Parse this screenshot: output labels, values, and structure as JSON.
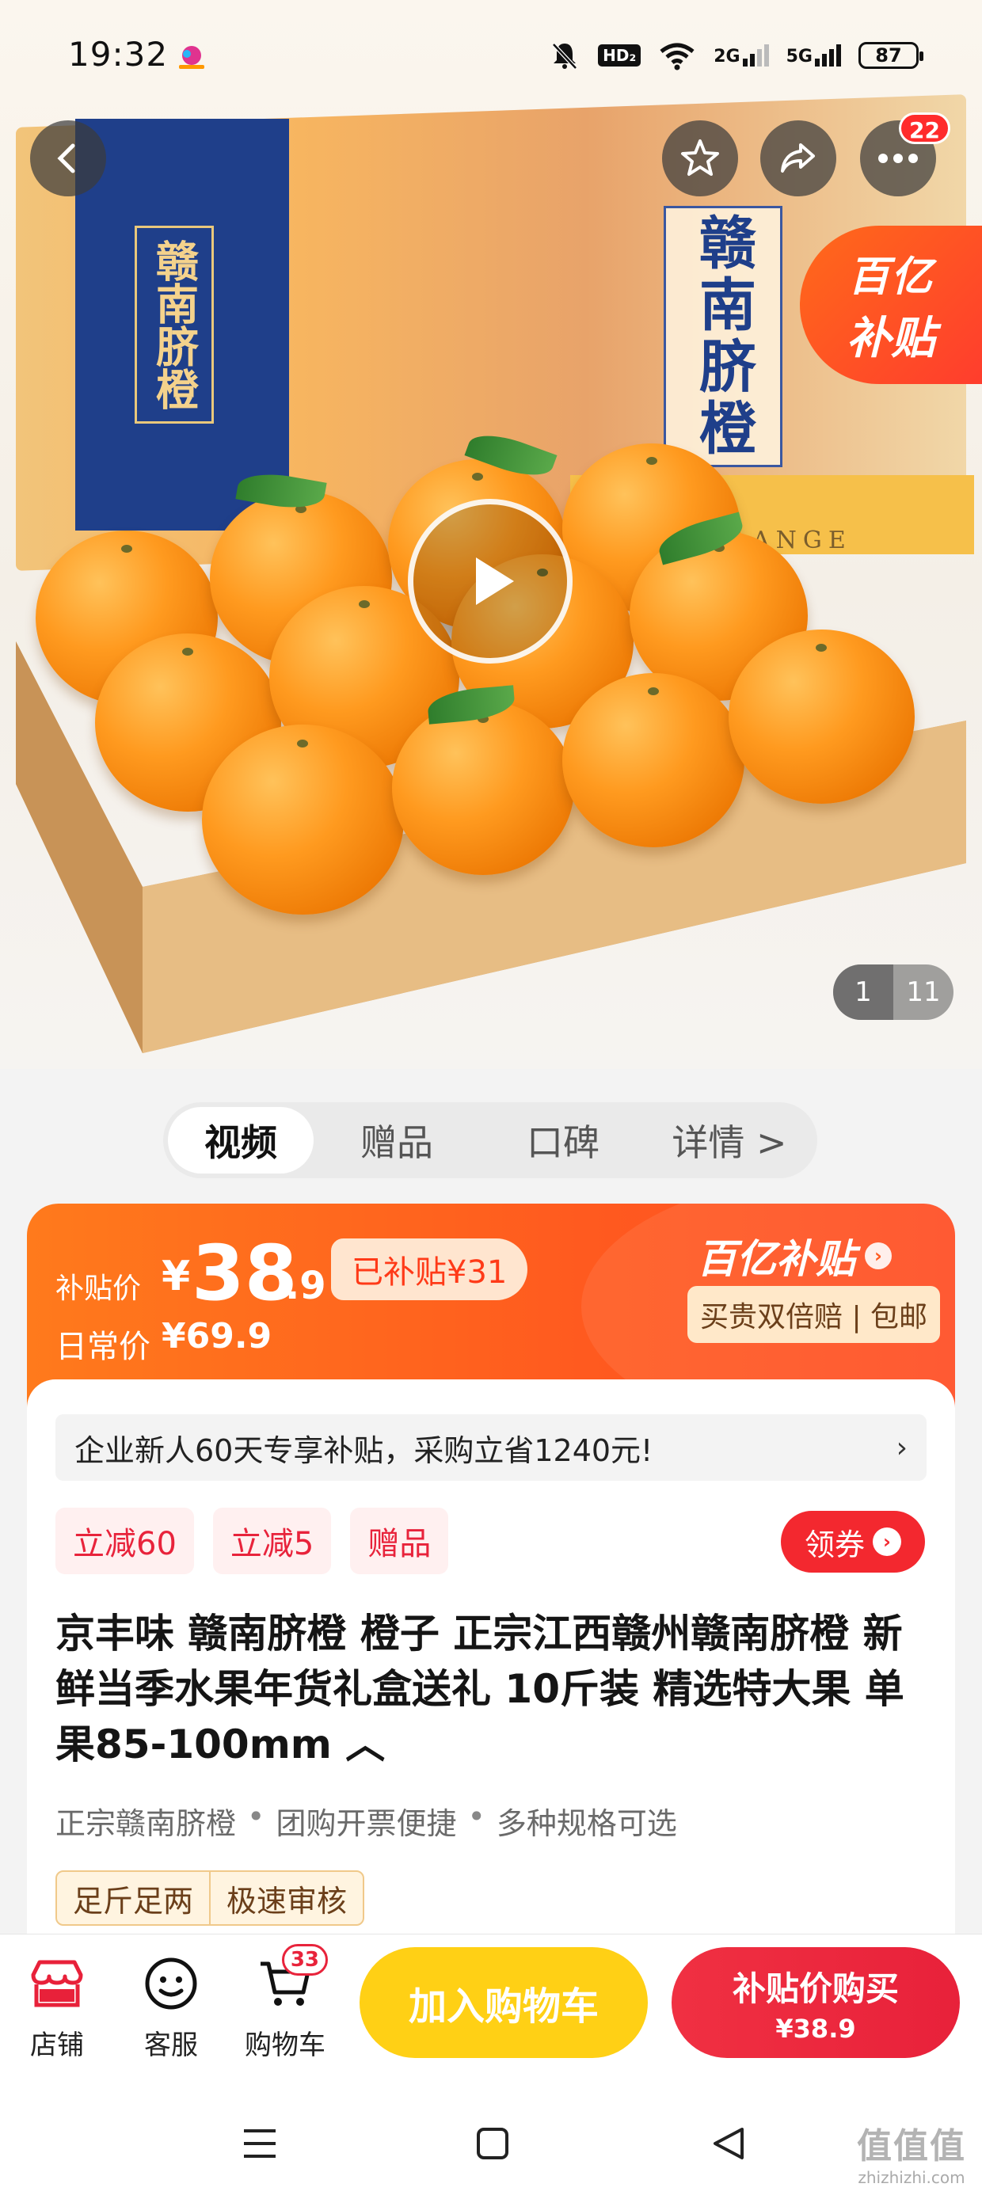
{
  "status_bar": {
    "time": "19:32",
    "hd": "HD₂",
    "net1": "2G",
    "net2": "5G",
    "battery": "87"
  },
  "header": {
    "more_badge": "22"
  },
  "hero": {
    "box_brand_left": "赣南脐橙",
    "box_brand_front": "赣南脐橙",
    "box_band_text": "ANGE",
    "subsidy_tag_top": "百亿",
    "subsidy_tag_bottom": "补贴",
    "image_index": "1",
    "image_total": "11"
  },
  "tabs": [
    {
      "label": "视频"
    },
    {
      "label": "赠品"
    },
    {
      "label": "口碑"
    },
    {
      "label": "详情 >"
    }
  ],
  "price": {
    "label": "补贴价",
    "yen": "¥",
    "integer": "38",
    "decimal": ".9",
    "subsidized": "已补贴¥31",
    "daily_label": "日常价",
    "daily_value": "¥69.9",
    "brand": "百亿补贴",
    "guarantee": "买贵双倍赔 | 包邮"
  },
  "promo": {
    "text": "企业新人60天专享补贴，采购立省1240元!",
    "chevron": "›"
  },
  "chips": [
    {
      "label": "立减60"
    },
    {
      "label": "立减5"
    },
    {
      "label": "赠品"
    }
  ],
  "coupon": {
    "label": "领券"
  },
  "product": {
    "title": "京丰味 赣南脐橙 橙子 正宗江西赣州赣南脐橙 新鲜当季水果年货礼盒送礼 10斤装 精选特大果 单果85-100mm ︿",
    "features": [
      "正宗赣南脐橙",
      "团购开票便捷",
      "多种规格可选"
    ],
    "tags": [
      "足斤足两",
      "极速审核"
    ]
  },
  "action_bar": {
    "shop": "店铺",
    "service": "客服",
    "cart": "购物车",
    "cart_badge": "33",
    "add_to_cart": "加入购物车",
    "buy_now": "补贴价购买",
    "buy_price": "¥38.9"
  },
  "watermark": {
    "line1": "值值值",
    "line2": "zhizhizhi.com"
  },
  "colors": {
    "accent_orange": "#ff5a1f",
    "add_cart_yellow": "#ffd015",
    "buy_red": "#e8213a"
  }
}
